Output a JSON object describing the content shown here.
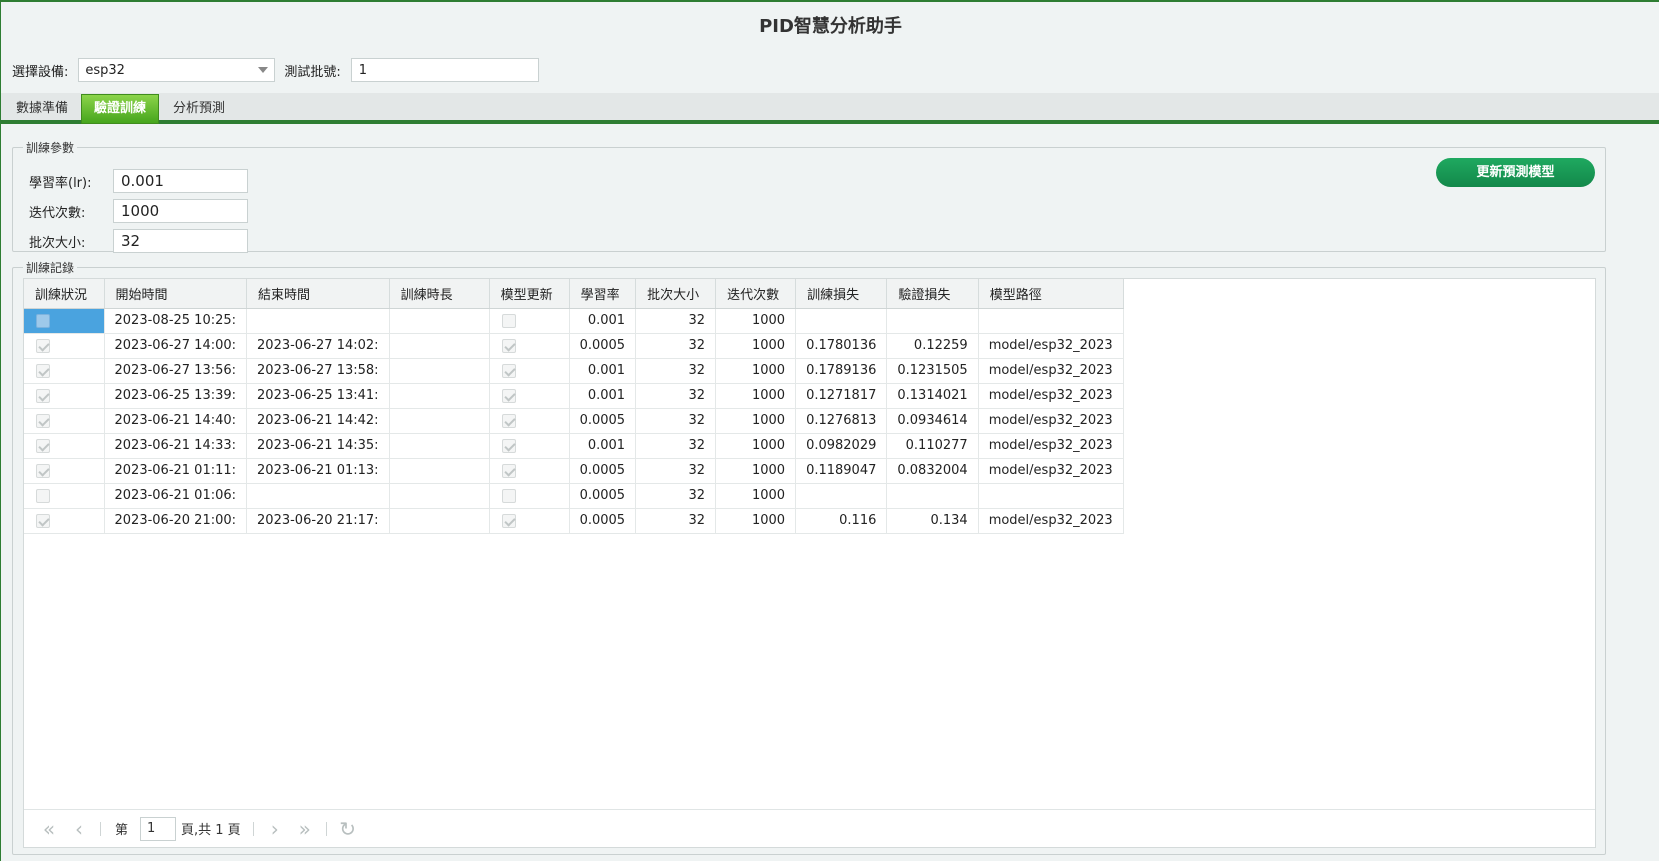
{
  "app": {
    "title": "PID智慧分析助手"
  },
  "toolbar": {
    "device_label": "選擇設備:",
    "device_value": "esp32",
    "batch_label": "測試批號:",
    "batch_value": "1"
  },
  "tabs": [
    "數據準備",
    "驗證訓練",
    "分析預測"
  ],
  "params": {
    "legend": "訓練參數",
    "lr_label": "學習率(lr):",
    "lr_value": "0.001",
    "iter_label": "迭代次數:",
    "iter_value": "1000",
    "batch_label": "批次大小:",
    "batch_value": "32",
    "update_button": "更新預測模型"
  },
  "records": {
    "legend": "訓練記錄",
    "columns": [
      "訓練狀況",
      "開始時間",
      "結束時間",
      "訓練時長",
      "模型更新",
      "學習率",
      "批次大小",
      "迭代次數",
      "訓練損失",
      "驗證損失",
      "模型路徑"
    ],
    "rows": [
      {
        "status": false,
        "start": "2023-08-25 10:25:",
        "end": "",
        "duration": "",
        "updated": false,
        "lr": "0.001",
        "batch": "32",
        "iter": "1000",
        "train_loss": "",
        "val_loss": "",
        "path": ""
      },
      {
        "status": true,
        "start": "2023-06-27 14:00:",
        "end": "2023-06-27 14:02:",
        "duration": "",
        "updated": true,
        "lr": "0.0005",
        "batch": "32",
        "iter": "1000",
        "train_loss": "0.1780136",
        "val_loss": "0.12259",
        "path": "model/esp32_2023"
      },
      {
        "status": true,
        "start": "2023-06-27 13:56:",
        "end": "2023-06-27 13:58:",
        "duration": "",
        "updated": true,
        "lr": "0.001",
        "batch": "32",
        "iter": "1000",
        "train_loss": "0.1789136",
        "val_loss": "0.1231505",
        "path": "model/esp32_2023"
      },
      {
        "status": true,
        "start": "2023-06-25 13:39:",
        "end": "2023-06-25 13:41:",
        "duration": "",
        "updated": true,
        "lr": "0.001",
        "batch": "32",
        "iter": "1000",
        "train_loss": "0.1271817",
        "val_loss": "0.1314021",
        "path": "model/esp32_2023"
      },
      {
        "status": true,
        "start": "2023-06-21 14:40:",
        "end": "2023-06-21 14:42:",
        "duration": "",
        "updated": true,
        "lr": "0.0005",
        "batch": "32",
        "iter": "1000",
        "train_loss": "0.1276813",
        "val_loss": "0.0934614",
        "path": "model/esp32_2023"
      },
      {
        "status": true,
        "start": "2023-06-21 14:33:",
        "end": "2023-06-21 14:35:",
        "duration": "",
        "updated": true,
        "lr": "0.001",
        "batch": "32",
        "iter": "1000",
        "train_loss": "0.0982029",
        "val_loss": "0.110277",
        "path": "model/esp32_2023"
      },
      {
        "status": true,
        "start": "2023-06-21 01:11:",
        "end": "2023-06-21 01:13:",
        "duration": "",
        "updated": true,
        "lr": "0.0005",
        "batch": "32",
        "iter": "1000",
        "train_loss": "0.1189047",
        "val_loss": "0.0832004",
        "path": "model/esp32_2023"
      },
      {
        "status": false,
        "start": "2023-06-21 01:06:",
        "end": "",
        "duration": "",
        "updated": false,
        "lr": "0.0005",
        "batch": "32",
        "iter": "1000",
        "train_loss": "",
        "val_loss": "",
        "path": ""
      },
      {
        "status": true,
        "start": "2023-06-20 21:00:",
        "end": "2023-06-20 21:17:",
        "duration": "",
        "updated": true,
        "lr": "0.0005",
        "batch": "32",
        "iter": "1000",
        "train_loss": "0.116",
        "val_loss": "0.134",
        "path": "model/esp32_2023"
      }
    ]
  },
  "pager": {
    "prefix": "第",
    "page": "1",
    "suffix": "頁,共 1 頁"
  },
  "icons": [
    "first-page-icon",
    "prev-page-icon",
    "next-page-icon",
    "last-page-icon",
    "refresh-icon",
    "dropdown-caret-icon"
  ],
  "colors": {
    "accent": "#2e7d32",
    "tab_active": "#46a51d",
    "button": "#13884a",
    "selection": "#4aa3df"
  }
}
